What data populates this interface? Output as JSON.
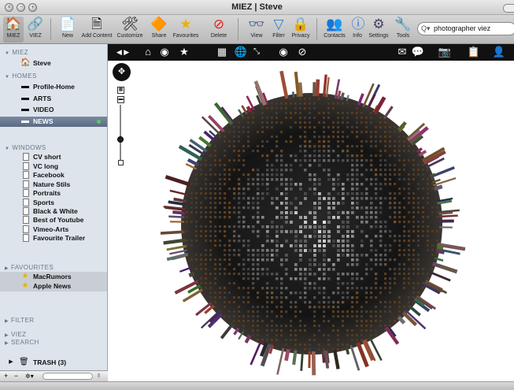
{
  "window": {
    "title": "MIEZ | Steve"
  },
  "toolbar": {
    "items": [
      {
        "label": "MIEZ",
        "icon": "home-icon"
      },
      {
        "label": "VIEZ",
        "icon": "viez-icon"
      },
      {
        "label": "New",
        "icon": "new-document-icon"
      },
      {
        "label": "Add Content",
        "icon": "add-content-icon"
      },
      {
        "label": "Customize",
        "icon": "tools-icon"
      },
      {
        "label": "Share",
        "icon": "share-sign-icon"
      },
      {
        "label": "Favourites",
        "icon": "star-icon"
      },
      {
        "label": "Delete",
        "icon": "delete-icon"
      },
      {
        "label": "View",
        "icon": "binoculars-icon"
      },
      {
        "label": "Filter",
        "icon": "filter-icon"
      },
      {
        "label": "Privacy",
        "icon": "lock-icon"
      },
      {
        "label": "Contacts",
        "icon": "contacts-icon"
      },
      {
        "label": "Info",
        "icon": "info-icon"
      },
      {
        "label": "Settings",
        "icon": "gear-icon"
      },
      {
        "label": "Tools",
        "icon": "tools-icon"
      }
    ],
    "search": {
      "value": "photographer viez"
    }
  },
  "sidebar": {
    "miez": {
      "header": "MIEZ",
      "items": [
        {
          "label": "Steve"
        }
      ]
    },
    "homes": {
      "header": "HOMES",
      "items": [
        {
          "label": "Profile-Home"
        },
        {
          "label": "ARTS"
        },
        {
          "label": "VIDEO"
        },
        {
          "label": "NEWS"
        }
      ]
    },
    "windows": {
      "header": "WINDOWS",
      "items": [
        {
          "label": "CV short"
        },
        {
          "label": "VC long"
        },
        {
          "label": "Facebook"
        },
        {
          "label": "Nature Stils"
        },
        {
          "label": "Portraits"
        },
        {
          "label": "Sports"
        },
        {
          "label": "Black & White"
        },
        {
          "label": "Best of Youtube"
        },
        {
          "label": "Vimeo-Arts"
        },
        {
          "label": "Favourite Trailer"
        }
      ]
    },
    "favourites": {
      "header": "FAVOURITES",
      "items": [
        {
          "label": "MacRumors"
        },
        {
          "label": "Apple News"
        }
      ]
    },
    "filter": {
      "header": "FILTER"
    },
    "viez": {
      "header": "VIEZ"
    },
    "search": {
      "header": "SEARCH"
    },
    "trash": {
      "label": "TRASH (3)"
    },
    "bottom": {
      "add": "+",
      "remove": "−",
      "gear": "✲▾"
    }
  },
  "viewbar": {
    "icons": [
      "prev-next-icon",
      "home-icon",
      "record-icon",
      "star-icon",
      "grid-icon",
      "globe-icon",
      "expand-icon",
      "eye-icon",
      "compass-icon",
      "mail-icon",
      "chat-icon",
      "camera-icon",
      "clipboard-icon",
      "user-icon"
    ]
  }
}
